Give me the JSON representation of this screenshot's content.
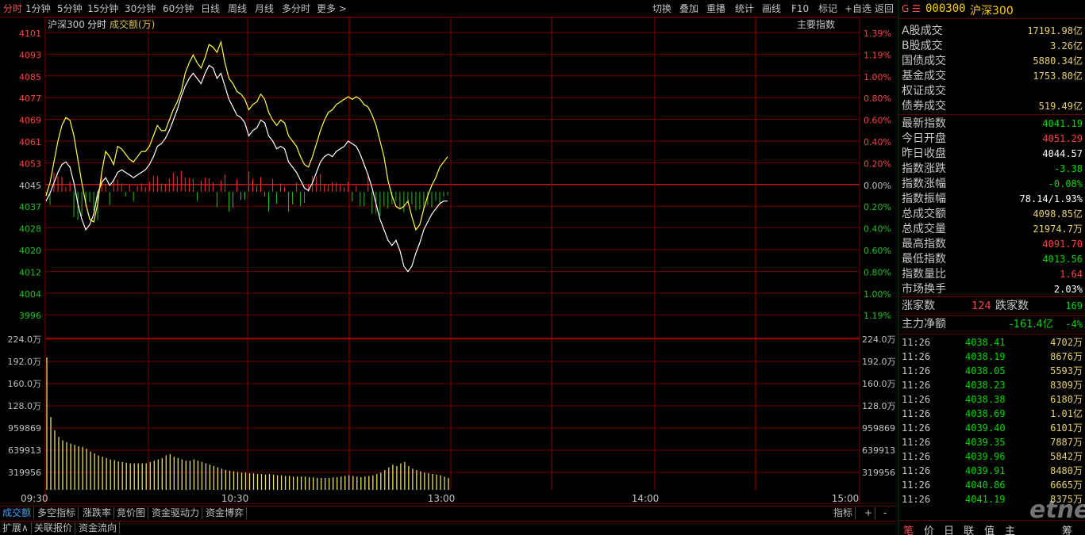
{
  "toolbar": {
    "periods": [
      "分时",
      "1分钟",
      "5分钟",
      "15分钟",
      "30分钟",
      "60分钟",
      "日线",
      "周线",
      "月线",
      "多分时",
      "更多 >"
    ],
    "actions": [
      "切换",
      "叠加",
      "重播",
      "统计",
      "画线",
      "F10",
      "标记",
      "+自选",
      "返回"
    ]
  },
  "chart_header": {
    "index_name": "沪深300",
    "mode": "分时",
    "volume_label": "成交额(万)",
    "right_label": "主要指数"
  },
  "price_axis": {
    "left": [
      "4101",
      "4093",
      "4085",
      "4077",
      "4069",
      "4061",
      "4053",
      "4045",
      "4037",
      "4028",
      "4020",
      "4012",
      "4004",
      "3996"
    ],
    "right": [
      "1.39%",
      "1.19%",
      "1.00%",
      "0.80%",
      "0.60%",
      "0.40%",
      "0.20%",
      "0.00%",
      "0.20%",
      "0.40%",
      "0.60%",
      "0.80%",
      "1.00%",
      "1.19%"
    ]
  },
  "volume_axis": {
    "labels": [
      "224.0万",
      "192.0万",
      "160.0万",
      "128.0万",
      "959869",
      "639913",
      "319956"
    ]
  },
  "time_axis": {
    "labels": [
      "09:30",
      "10:30",
      "13:00",
      "14:00",
      "15:00"
    ]
  },
  "chart_data": {
    "type": "line",
    "title": "",
    "xlabel": "",
    "ylabel": "",
    "ylim": [
      3992,
      4105
    ],
    "base": 4044.57,
    "series": [
      {
        "values": [
          4043,
          4048,
          4056,
          4064,
          4070,
          4073,
          4072,
          4066,
          4057,
          4048,
          4040,
          4034,
          4033,
          4040,
          4052,
          4060,
          4058,
          4055,
          4062,
          4061,
          4059,
          4057,
          4056,
          4058,
          4060,
          4060,
          4062,
          4066,
          4070,
          4068,
          4068,
          4072,
          4076,
          4079,
          4083,
          4090,
          4094,
          4097,
          4094,
          4092,
          4096,
          4101,
          4100,
          4098,
          4102,
          4094,
          4088,
          4086,
          4083,
          4082,
          4080,
          4076,
          4078,
          4079,
          4082,
          4080,
          4075,
          4072,
          4070,
          4072,
          4071,
          4066,
          4064,
          4062,
          4058,
          4055,
          4054,
          4058,
          4063,
          4068,
          4072,
          4075,
          4076,
          4078,
          4079,
          4080,
          4081,
          4080,
          4081,
          4080,
          4078,
          4077,
          4074,
          4070,
          4064,
          4058,
          4049,
          4043,
          4039,
          4038,
          4039,
          4041,
          4035,
          4030,
          4032,
          4038,
          4043,
          4047,
          4050,
          4054,
          4056,
          4058
        ]
      },
      {
        "values": [
          4041,
          4044,
          4048,
          4052,
          4055,
          4056,
          4054,
          4048,
          4040,
          4034,
          4030,
          4032,
          4036,
          4044,
          4048,
          4050,
          4047,
          4049,
          4052,
          4053,
          4052,
          4051,
          4050,
          4051,
          4052,
          4053,
          4055,
          4058,
          4062,
          4063,
          4065,
          4068,
          4072,
          4076,
          4081,
          4085,
          4088,
          4090,
          4088,
          4086,
          4090,
          4093,
          4092,
          4088,
          4090,
          4085,
          4080,
          4077,
          4074,
          4073,
          4071,
          4066,
          4068,
          4069,
          4072,
          4071,
          4066,
          4064,
          4061,
          4062,
          4061,
          4056,
          4054,
          4052,
          4049,
          4046,
          4045,
          4048,
          4052,
          4056,
          4058,
          4059,
          4058,
          4060,
          4061,
          4062,
          4064,
          4063,
          4062,
          4059,
          4055,
          4051,
          4046,
          4040,
          4034,
          4030,
          4026,
          4024,
          4026,
          4022,
          4016,
          4014,
          4016,
          4021,
          4025,
          4030,
          4033,
          4036,
          4038,
          4040,
          4041,
          4041
        ]
      },
      {
        "name": "成交额",
        "values": [
          20,
          11,
          9,
          8,
          7.5,
          7.2,
          7,
          6.8,
          6.6,
          6.5,
          6.2,
          5.8,
          5.5,
          5.2,
          5,
          4.8,
          4.6,
          4.5,
          4.3,
          4.2,
          4.1,
          4,
          4,
          4,
          4,
          4,
          4.2,
          4.4,
          4.6,
          4.8,
          5.2,
          5.4,
          5,
          4.8,
          4.6,
          4.4,
          4.4,
          4.6,
          4.4,
          4.2,
          4,
          3.8,
          3.6,
          3.4,
          3.2,
          3,
          2.9,
          2.8,
          2.7,
          2.6,
          2.6,
          2.5,
          2.5,
          2.4,
          2.4,
          2.3,
          2.4,
          2.3,
          2.2,
          2.2,
          2.1,
          2.1,
          2,
          2,
          2,
          2,
          1.9,
          1.9,
          1.8,
          1.8,
          1.8,
          1.8,
          1.9,
          1.9,
          2,
          2.1,
          2.2,
          2.1,
          2,
          1.9,
          2,
          2.1,
          2.2,
          2.4,
          2.6,
          3,
          3.4,
          3.8,
          3.6,
          4,
          4.2,
          3.6,
          3.2,
          3,
          2.8,
          2.6,
          2.5,
          2.4,
          2.3,
          2.2,
          2,
          1.8
        ]
      }
    ]
  },
  "quote": [
    {
      "k": "A股成交",
      "v": "17191.98亿",
      "c": "#e8d070"
    },
    {
      "k": "B股成交",
      "v": "3.26亿",
      "c": "#e8d070"
    },
    {
      "k": "国债成交",
      "v": "5880.34亿",
      "c": "#e8d070"
    },
    {
      "k": "基金成交",
      "v": "1753.80亿",
      "c": "#e8d070"
    },
    {
      "k": "权证成交",
      "v": "",
      "c": "#e8d070"
    },
    {
      "k": "债券成交",
      "v": "519.49亿",
      "c": "#e8d070"
    },
    {
      "k": "最新指数",
      "v": "4041.19",
      "c": "#00d800"
    },
    {
      "k": "今日开盘",
      "v": "4051.29",
      "c": "#ff4040"
    },
    {
      "k": "昨日收盘",
      "v": "4044.57",
      "c": "#ffffff"
    },
    {
      "k": "指数涨跌",
      "v": "-3.38",
      "c": "#00d800"
    },
    {
      "k": "指数涨幅",
      "v": "-0.08%",
      "c": "#00d800"
    },
    {
      "k": "指数振幅",
      "v": "78.14/1.93%",
      "c": "#ffffff"
    },
    {
      "k": "总成交额",
      "v": "4098.85亿",
      "c": "#e8d070"
    },
    {
      "k": "总成交量",
      "v": "21974.7万",
      "c": "#e8d070"
    },
    {
      "k": "最高指数",
      "v": "4091.70",
      "c": "#ff4040"
    },
    {
      "k": "最低指数",
      "v": "4013.56",
      "c": "#00d800"
    },
    {
      "k": "指数量比",
      "v": "1.64",
      "c": "#ff4040"
    },
    {
      "k": "市场换手",
      "v": "2.03%",
      "c": "#ffffff"
    }
  ],
  "header": {
    "prefix": "G ☰",
    "code": "000300",
    "name": "沪深300"
  },
  "breadth": {
    "up_label": "涨家数",
    "up": "124",
    "down_label": "跌家数",
    "down": "169"
  },
  "mainforce": {
    "label": "主力净额",
    "value": "-161.4亿",
    "pct": "-4%"
  },
  "ticks": [
    {
      "t": "11:26",
      "p": "4038.41",
      "v": "4702万"
    },
    {
      "t": "11:26",
      "p": "4038.19",
      "v": "8676万"
    },
    {
      "t": "11:26",
      "p": "4038.05",
      "v": "5593万"
    },
    {
      "t": "11:26",
      "p": "4038.23",
      "v": "8309万"
    },
    {
      "t": "11:26",
      "p": "4038.38",
      "v": "6180万"
    },
    {
      "t": "11:26",
      "p": "4038.69",
      "v": "1.01亿"
    },
    {
      "t": "11:26",
      "p": "4039.40",
      "v": "6101万"
    },
    {
      "t": "11:26",
      "p": "4039.35",
      "v": "7887万"
    },
    {
      "t": "11:26",
      "p": "4039.96",
      "v": "5842万"
    },
    {
      "t": "11:26",
      "p": "4039.91",
      "v": "8480万"
    },
    {
      "t": "11:26",
      "p": "4040.86",
      "v": "6665万"
    },
    {
      "t": "11:26",
      "p": "4041.19",
      "v": "8375万"
    }
  ],
  "bottom_tabs1": [
    "成交额",
    "多空指标",
    "涨跌率",
    "竞价图",
    "资金驱动力",
    "资金博弈"
  ],
  "bottom_right": [
    "指标",
    "+",
    "-"
  ],
  "bottom_tabs2": [
    "扩展∧",
    "关联报价",
    "资金流向"
  ],
  "right_tabs": [
    "笔",
    "价",
    "日",
    "联",
    "值",
    "主",
    "筹"
  ],
  "watermark": "etnet"
}
